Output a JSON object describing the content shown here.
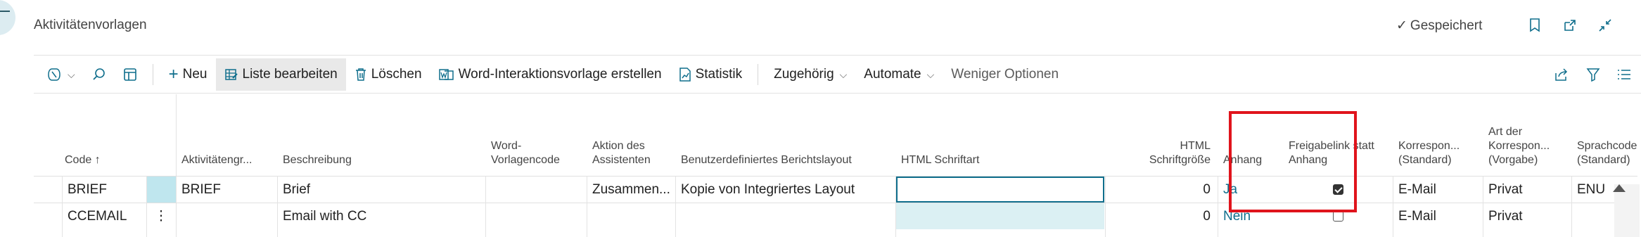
{
  "header": {
    "title": "Aktivitätenvorlagen",
    "saved_label": "Gespeichert",
    "checkmark": "✓"
  },
  "toolbar": {
    "new_label": "Neu",
    "edit_list_label": "Liste bearbeiten",
    "delete_label": "Löschen",
    "word_template_label": "Word-Interaktionsvorlage erstellen",
    "statistics_label": "Statistik",
    "related_label": "Zugehörig",
    "automate_label": "Automate",
    "fewer_options_label": "Weniger Optionen"
  },
  "columns": {
    "code": "Code",
    "sort_arrow": "↑",
    "activity_group": "Aktivitätengr...",
    "description": "Beschreibung",
    "word_template_code_1": "Word-",
    "word_template_code_2": "Vorlagencode",
    "wizard_action_1": "Aktion des",
    "wizard_action_2": "Assistenten",
    "custom_layout": "Benutzerdefiniertes Berichtslayout",
    "html_font": "HTML Schriftart",
    "html_font_size_1": "HTML",
    "html_font_size_2": "Schriftgröße",
    "attachment": "Anhang",
    "share_link_1": "Freigabelink statt",
    "share_link_2": "Anhang",
    "correspondence_1": "Korrespon...",
    "correspondence_2": "(Standard)",
    "corr_type_1": "Art der",
    "corr_type_2": "Korrespon...",
    "corr_type_3": "(Vorgabe)",
    "language_1": "Sprachcode",
    "language_2": "(Standard)"
  },
  "rows": [
    {
      "code": "BRIEF",
      "activity_group": "BRIEF",
      "description": "Brief",
      "word_template_code": "",
      "wizard_action": "Zusammen...",
      "custom_layout": "Kopie von Integriertes Layout",
      "html_font": "",
      "html_font_size": "0",
      "attachment": "Ja",
      "share_link": true,
      "correspondence": "E-Mail",
      "corr_type": "Privat",
      "language": "ENU"
    },
    {
      "code": "CCEMAIL",
      "row_menu": "⋮",
      "activity_group": "",
      "description": "Email with CC",
      "word_template_code": "",
      "wizard_action": "",
      "custom_layout": "",
      "html_font": "",
      "html_font_size": "0",
      "attachment": "Nein",
      "share_link": false,
      "correspondence": "E-Mail",
      "corr_type": "Privat",
      "language": ""
    }
  ],
  "colors": {
    "accent": "#0f6e8c",
    "highlight_box": "#e0141c",
    "selection": "#bfe6ee"
  }
}
